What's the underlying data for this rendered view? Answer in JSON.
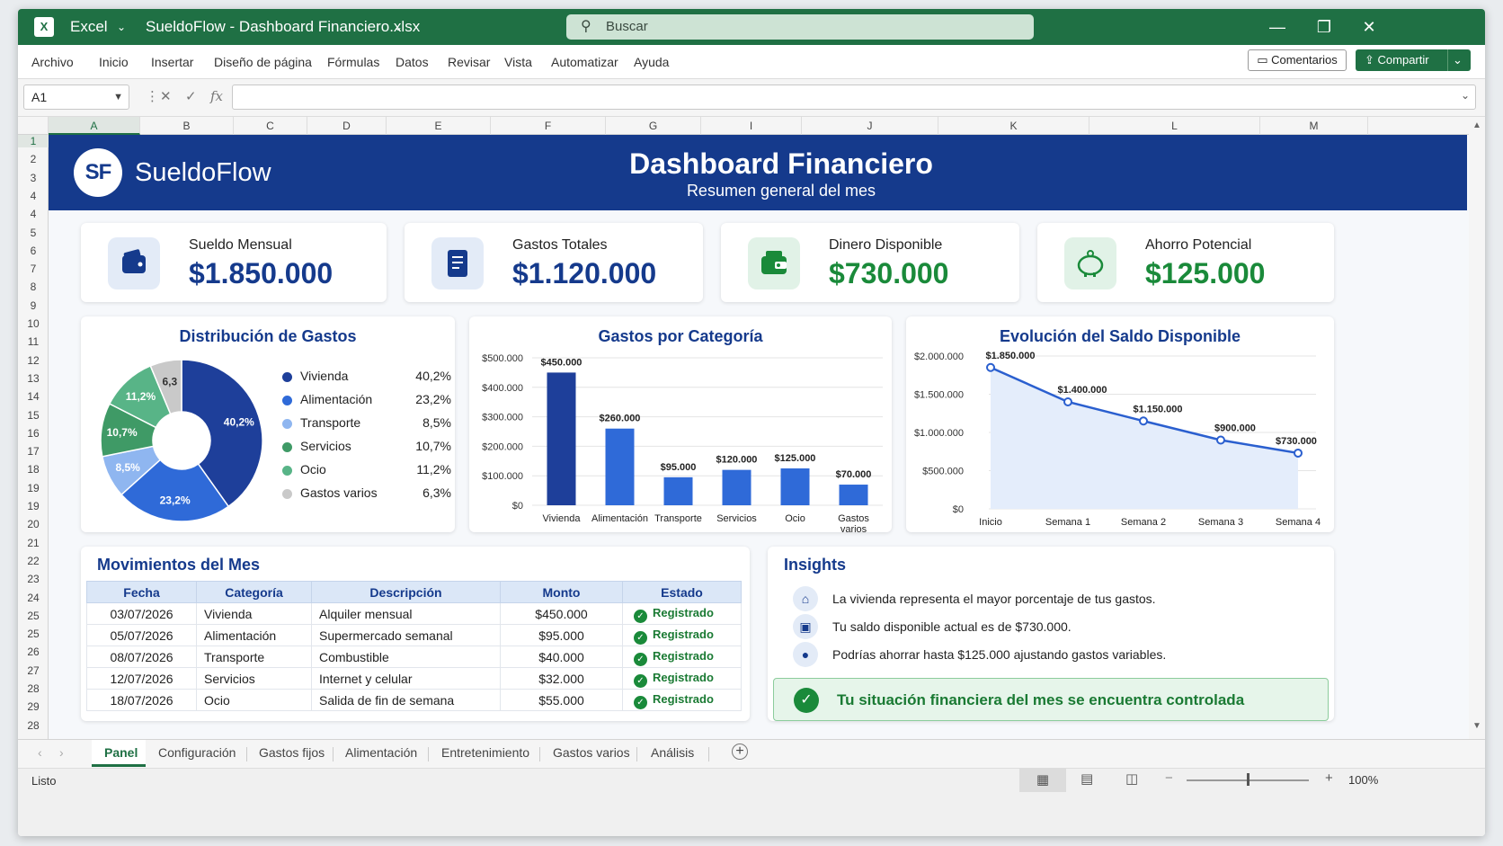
{
  "app": {
    "name": "Excel",
    "file": "SueldoFlow - Dashboard Financiero.xlsx",
    "search_placeholder": "Buscar"
  },
  "menu": [
    "Archivo",
    "Inicio",
    "Insertar",
    "Diseño de página",
    "Fórmulas",
    "Datos",
    "Revisar",
    "Vista",
    "Automatizar",
    "Ayuda"
  ],
  "buttons": {
    "comments": "Comentarios",
    "share": "Compartir"
  },
  "formula_bar": {
    "cell": "A1",
    "fx": "fx",
    "value": ""
  },
  "columns": [
    "A",
    "B",
    "C",
    "D",
    "E",
    "F",
    "G",
    "I",
    "J",
    "K",
    "L",
    "M"
  ],
  "rows": [
    "1",
    "2",
    "3",
    "4",
    "4",
    "5",
    "6",
    "7",
    "8",
    "9",
    "10",
    "11",
    "12",
    "13",
    "14",
    "15",
    "16",
    "17",
    "18",
    "19",
    "19",
    "20",
    "21",
    "22",
    "23",
    "24",
    "25",
    "25",
    "26",
    "27",
    "28",
    "29",
    "28"
  ],
  "banner": {
    "logo": "SF",
    "brand": "SueldoFlow",
    "title": "Dashboard Financiero",
    "subtitle": "Resumen general del mes"
  },
  "kpis": [
    {
      "label": "Sueldo Mensual",
      "value": "$1.850.000",
      "color": "#153a8c",
      "icon": "wallet-icon"
    },
    {
      "label": "Gastos Totales",
      "value": "$1.120.000",
      "color": "#153a8c",
      "icon": "receipt-icon"
    },
    {
      "label": "Dinero Disponible",
      "value": "$730.000",
      "color": "#1a8a3a",
      "icon": "money-wallet-icon"
    },
    {
      "label": "Ahorro Potencial",
      "value": "$125.000",
      "color": "#1a8a3a",
      "icon": "piggy-bank-icon"
    }
  ],
  "colors": {
    "primary": "#153a8c",
    "green": "#1a8a3a",
    "excel": "#1f7044"
  },
  "chart_data": [
    {
      "type": "pie",
      "title": "Distribución de Gastos",
      "categories": [
        "Vivienda",
        "Alimentación",
        "Transporte",
        "Servicios",
        "Ocio",
        "Gastos varios"
      ],
      "values": [
        40.2,
        23.2,
        8.5,
        10.7,
        11.2,
        6.3
      ],
      "labels": [
        "40,2%",
        "23,2%",
        "8,5%",
        "10,7%",
        "11,2%",
        "6,3%"
      ],
      "slice_labels": [
        "40,2%",
        "23,2%",
        "8,5%",
        "10,7%",
        "11,2%",
        "6,3"
      ],
      "colors": [
        "#1e3f9a",
        "#2f6ad8",
        "#8fb6f0",
        "#3f9a66",
        "#58b487",
        "#c9c9c9"
      ],
      "legend": "right"
    },
    {
      "type": "bar",
      "title": "Gastos por Categoría",
      "categories": [
        "Vivienda",
        "Alimentación",
        "Transporte",
        "Servicios",
        "Ocio",
        "Gastos varios"
      ],
      "values": [
        450000,
        260000,
        95000,
        120000,
        125000,
        70000
      ],
      "value_labels": [
        "$450.000",
        "$260.000",
        "$95.000",
        "$120.000",
        "$125.000",
        "$70.000"
      ],
      "yticks": [
        "$0",
        "$100.000",
        "$200.000",
        "$300.000",
        "$400.000",
        "$500.000"
      ],
      "ylim": [
        0,
        500000
      ],
      "grid": true
    },
    {
      "type": "area",
      "title": "Evolución del Saldo Disponible",
      "categories": [
        "Inicio",
        "Semana 1",
        "Semana 2",
        "Semana 3",
        "Semana 4"
      ],
      "values": [
        1850000,
        1400000,
        1150000,
        900000,
        730000
      ],
      "value_labels": [
        "$1.850.000",
        "$1.400.000",
        "$1.150.000",
        "$900.000",
        "$730.000"
      ],
      "yticks": [
        "$0",
        "$500.000",
        "$1.000.000",
        "$1.500.000",
        "$2.000.000"
      ],
      "ylim": [
        0,
        2000000
      ],
      "grid": true
    }
  ],
  "movimientos": {
    "title": "Movimientos del Mes",
    "headers": [
      "Fecha",
      "Categoría",
      "Descripción",
      "Monto",
      "Estado"
    ],
    "rows": [
      [
        "03/07/2026",
        "Vivienda",
        "Alquiler mensual",
        "$450.000",
        "Registrado"
      ],
      [
        "05/07/2026",
        "Alimentación",
        "Supermercado semanal",
        "$95.000",
        "Registrado"
      ],
      [
        "08/07/2026",
        "Transporte",
        "Combustible",
        "$40.000",
        "Registrado"
      ],
      [
        "12/07/2026",
        "Servicios",
        "Internet y celular",
        "$32.000",
        "Registrado"
      ],
      [
        "18/07/2026",
        "Ocio",
        "Salida de fin de semana",
        "$55.000",
        "Registrado"
      ]
    ]
  },
  "insights": {
    "title": "Insights",
    "items": [
      {
        "icon": "home-icon",
        "text": "La vivienda representa el mayor porcentaje de tus gastos."
      },
      {
        "icon": "wallet-icon",
        "text": "Tu saldo disponible actual es de $730.000."
      },
      {
        "icon": "piggy-bank-icon",
        "text": "Podrías ahorrar hasta $125.000 ajustando gastos variables."
      }
    ],
    "banner": "Tu situación financiera del mes se encuentra controlada"
  },
  "tabs": [
    "Panel",
    "Configuración",
    "Gastos fijos",
    "Alimentación",
    "Entretenimiento",
    "Gastos varios",
    "Análisis"
  ],
  "status": {
    "ready": "Listo",
    "zoom": "100%"
  }
}
